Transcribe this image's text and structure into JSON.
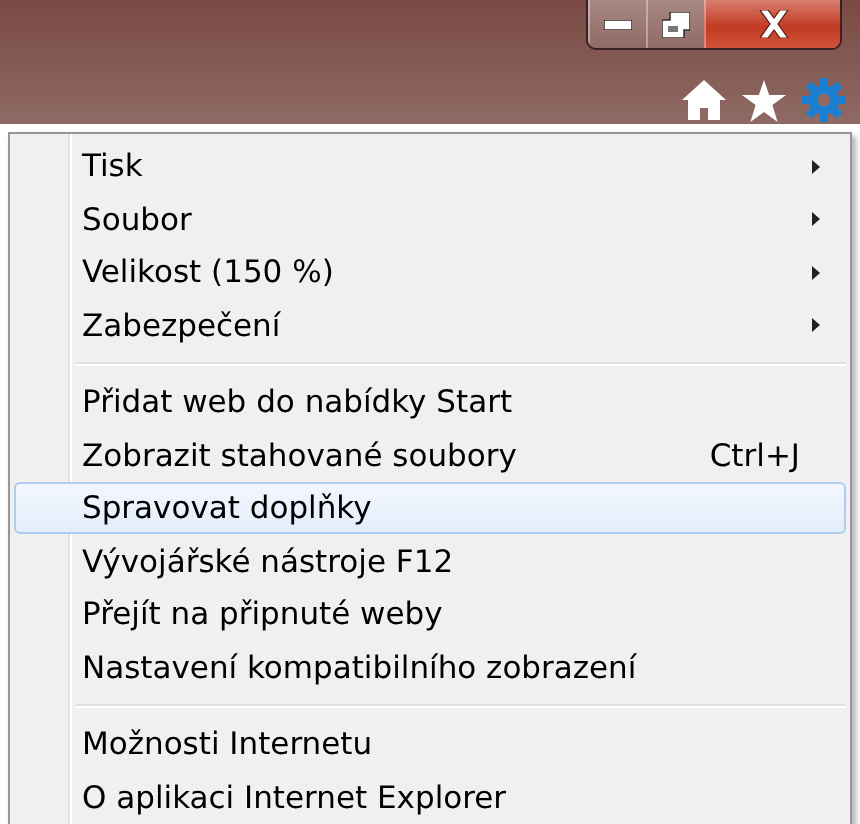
{
  "window_controls": [
    {
      "kind": "minimize"
    },
    {
      "kind": "restore"
    },
    {
      "kind": "close"
    }
  ],
  "toolbar": [
    {
      "kind": "home"
    },
    {
      "kind": "favorites"
    },
    {
      "kind": "settings"
    }
  ],
  "menu": {
    "groups": [
      {
        "items": [
          {
            "label": "Tisk",
            "submenu": true,
            "selected": false
          },
          {
            "label": "Soubor",
            "submenu": true,
            "selected": false
          },
          {
            "label": "Velikost (150 %)",
            "submenu": true,
            "selected": false
          },
          {
            "label": "Zabezpečení",
            "submenu": true,
            "selected": false
          }
        ]
      },
      {
        "items": [
          {
            "label": "Přidat web do nabídky Start",
            "submenu": false,
            "selected": false
          },
          {
            "label": "Zobrazit stahované soubory",
            "shortcut": "Ctrl+J",
            "submenu": false,
            "selected": false
          },
          {
            "label": "Spravovat doplňky",
            "submenu": false,
            "selected": true
          },
          {
            "label": "Vývojářské nástroje F12",
            "submenu": false,
            "selected": false
          },
          {
            "label": "Přejít na připnuté weby",
            "submenu": false,
            "selected": false
          },
          {
            "label": "Nastavení kompatibilního zobrazení",
            "submenu": false,
            "selected": false
          }
        ]
      },
      {
        "items": [
          {
            "label": "Možnosti Internetu",
            "submenu": false,
            "selected": false
          },
          {
            "label": "O aplikaci Internet Explorer",
            "submenu": false,
            "selected": false
          }
        ]
      }
    ]
  }
}
